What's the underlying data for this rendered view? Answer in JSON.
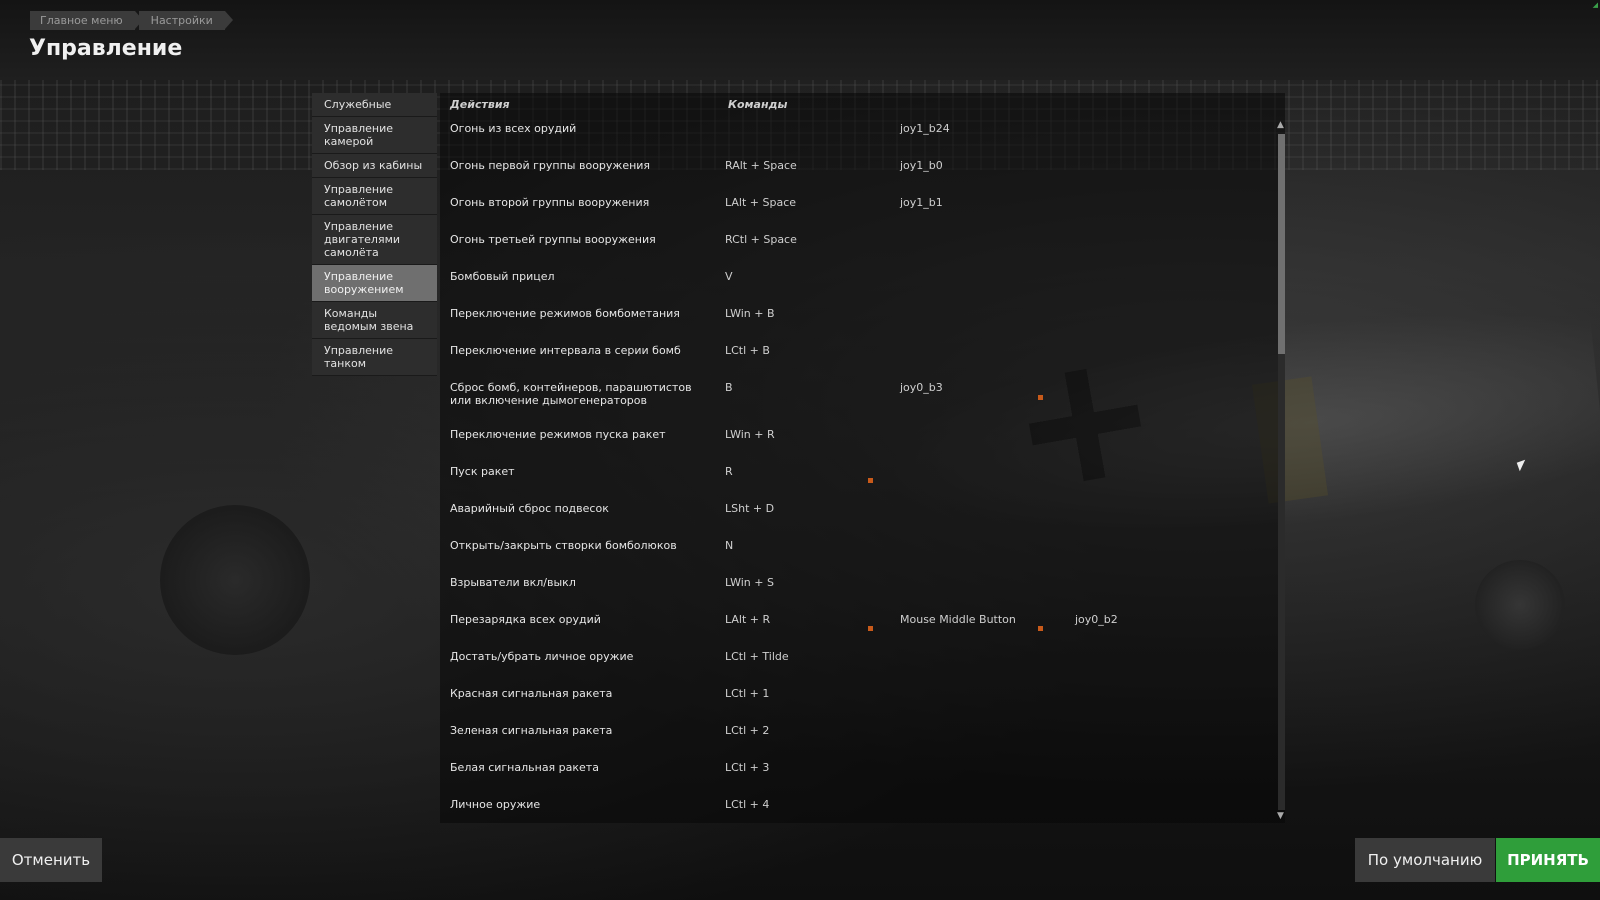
{
  "breadcrumb": [
    "Главное меню",
    "Настройки"
  ],
  "page_title": "Управление",
  "categories": [
    {
      "label": "Служебные",
      "active": false
    },
    {
      "label": "Управление камерой",
      "active": false
    },
    {
      "label": "Обзор из кабины",
      "active": false
    },
    {
      "label": "Управление самолётом",
      "active": false
    },
    {
      "label": "Управление двигателями самолёта",
      "active": false
    },
    {
      "label": "Управление вооружением",
      "active": true
    },
    {
      "label": "Команды ведомым звена",
      "active": false
    },
    {
      "label": "Управление танком",
      "active": false
    }
  ],
  "table": {
    "headers": {
      "actions": "Действия",
      "commands": "Команды"
    },
    "rows": [
      {
        "action": "Огонь из всех орудий",
        "cmd1": "",
        "cmd2": "joy1_b24",
        "cmd3": ""
      },
      {
        "action": "Огонь первой группы вооружения",
        "cmd1": "RAlt + Space",
        "cmd2": "joy1_b0",
        "cmd3": ""
      },
      {
        "action": "Огонь второй группы вооружения",
        "cmd1": "LAlt + Space",
        "cmd2": "joy1_b1",
        "cmd3": ""
      },
      {
        "action": "Огонь третьей группы вооружения",
        "cmd1": "RCtl + Space",
        "cmd2": "",
        "cmd3": ""
      },
      {
        "action": "Бомбовый прицел",
        "cmd1": "V",
        "cmd2": "",
        "cmd3": ""
      },
      {
        "action": "Переключение режимов бомбометания",
        "cmd1": "LWin + B",
        "cmd2": "",
        "cmd3": ""
      },
      {
        "action": "Переключение интервала в серии бомб",
        "cmd1": "LCtl + B",
        "cmd2": "",
        "cmd3": ""
      },
      {
        "action": "Сброс бомб, контейнеров, парашютистов или включение дымогенераторов",
        "cmd1": "B",
        "cmd2": "joy0_b3",
        "cmd3": ""
      },
      {
        "action": "Переключение режимов пуска ракет",
        "cmd1": "LWin + R",
        "cmd2": "",
        "cmd3": ""
      },
      {
        "action": "Пуск ракет",
        "cmd1": "R",
        "cmd2": "",
        "cmd3": ""
      },
      {
        "action": "Аварийный сброс подвесок",
        "cmd1": "LSht + D",
        "cmd2": "",
        "cmd3": ""
      },
      {
        "action": "Открыть/закрыть створки бомболюков",
        "cmd1": "N",
        "cmd2": "",
        "cmd3": ""
      },
      {
        "action": "Взрыватели вкл/выкл",
        "cmd1": "LWin + S",
        "cmd2": "",
        "cmd3": ""
      },
      {
        "action": "Перезарядка всех орудий",
        "cmd1": "LAlt + R",
        "cmd2": "Mouse Middle Button",
        "cmd3": "joy0_b2"
      },
      {
        "action": "Достать/убрать личное оружие",
        "cmd1": "LCtl + Tilde",
        "cmd2": "",
        "cmd3": ""
      },
      {
        "action": "Красная сигнальная ракета",
        "cmd1": "LCtl + 1",
        "cmd2": "",
        "cmd3": ""
      },
      {
        "action": "Зеленая сигнальная ракета",
        "cmd1": "LCtl + 2",
        "cmd2": "",
        "cmd3": ""
      },
      {
        "action": "Белая сигнальная ракета",
        "cmd1": "LCtl + 3",
        "cmd2": "",
        "cmd3": ""
      },
      {
        "action": "Личное оружие",
        "cmd1": "LCtl + 4",
        "cmd2": "",
        "cmd3": ""
      }
    ]
  },
  "buttons": {
    "cancel": "Отменить",
    "default": "По умолчанию",
    "accept": "ПРИНЯТЬ"
  },
  "colors": {
    "accept": "#2f9e3a",
    "active_category": "#6f6f6f",
    "conflict_marker": "#c85a1a"
  }
}
